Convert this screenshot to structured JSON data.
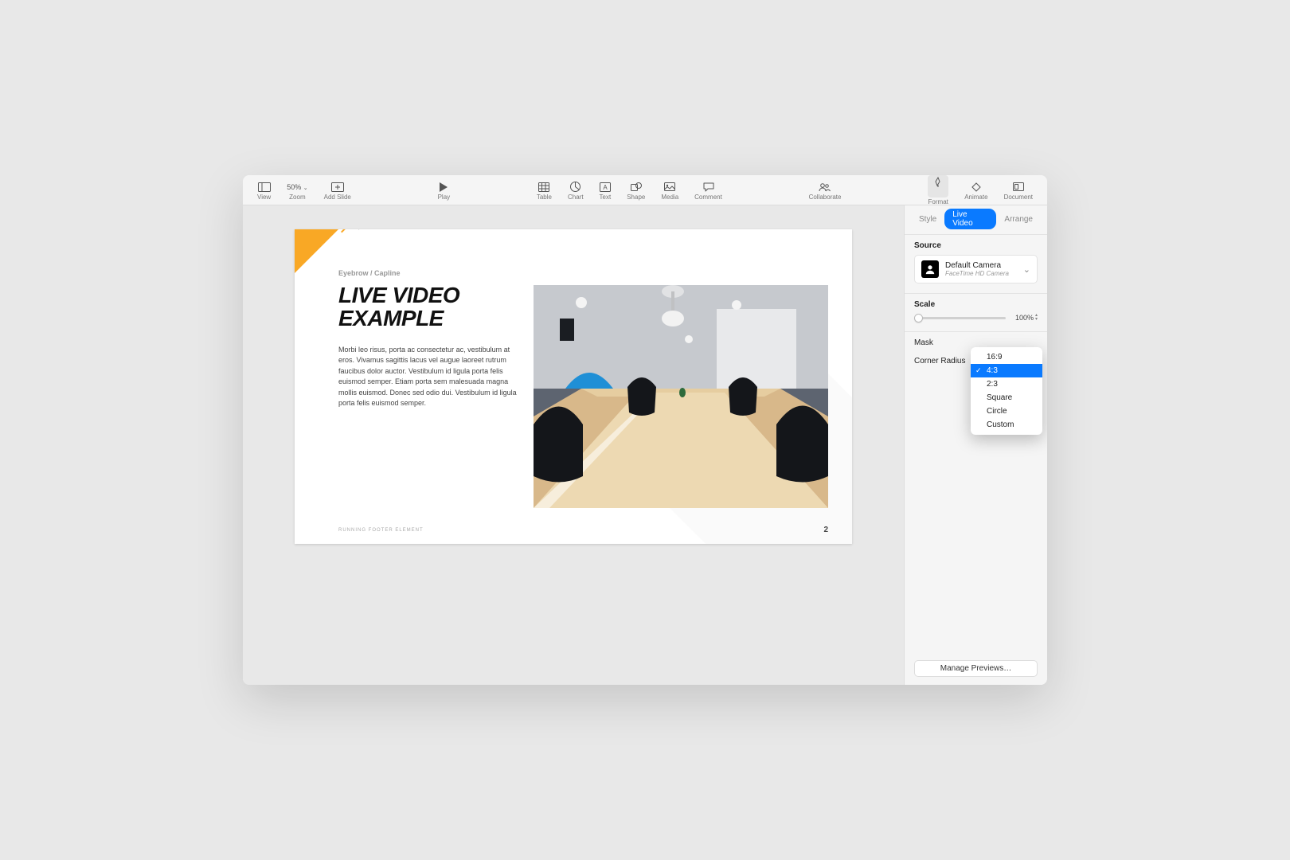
{
  "toolbar": {
    "view": "View",
    "zoom_label": "Zoom",
    "zoom_value": "50%",
    "add_slide": "Add Slide",
    "play": "Play",
    "table": "Table",
    "chart": "Chart",
    "text": "Text",
    "shape": "Shape",
    "media": "Media",
    "comment": "Comment",
    "collaborate": "Collaborate",
    "format": "Format",
    "animate": "Animate",
    "document": "Document"
  },
  "inspector": {
    "tabs": {
      "style": "Style",
      "live_video": "Live Video",
      "arrange": "Arrange"
    },
    "source_label": "Source",
    "source_name": "Default Camera",
    "source_sub": "FaceTime HD Camera",
    "scale_label": "Scale",
    "scale_value": "100%",
    "mask_label": "Mask",
    "corner_radius_label": "Corner Radius",
    "mask_options": [
      "16:9",
      "4:3",
      "2:3",
      "Square",
      "Circle",
      "Custom"
    ],
    "mask_selected": "4:3",
    "manage_previews": "Manage Previews…"
  },
  "slide": {
    "eyebrow": "Eyebrow / Capline",
    "title": "LIVE VIDEO EXAMPLE",
    "body": "Morbi leo risus, porta ac consectetur ac, vestibulum at eros. Vivamus sagittis lacus vel augue laoreet rutrum faucibus dolor auctor. Vestibulum id ligula porta felis euismod semper. Etiam porta sem malesuada magna mollis euismod. Donec sed odio dui. Vestibulum id ligula porta felis euismod semper.",
    "footer": "RUNNING FOOTER ELEMENT",
    "page": "2"
  }
}
